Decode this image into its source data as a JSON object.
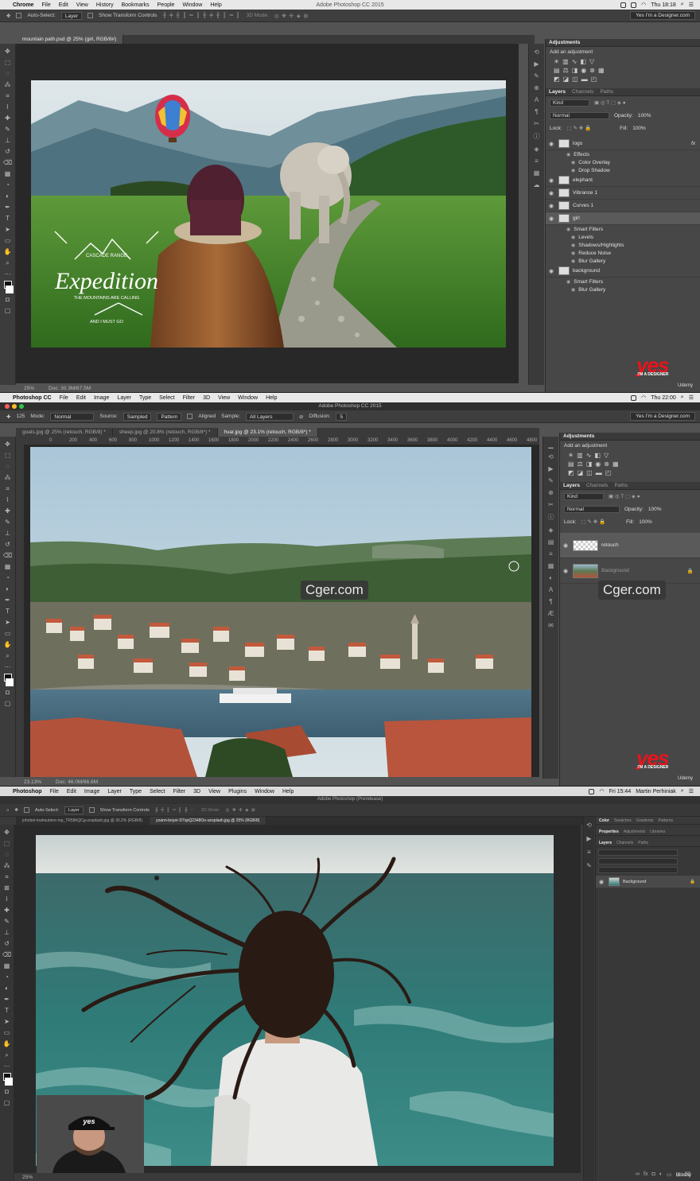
{
  "screen1": {
    "menubar": {
      "app": "Chrome",
      "items": [
        "File",
        "Edit",
        "View",
        "History",
        "Bookmarks",
        "People",
        "Window",
        "Help"
      ],
      "title": "Adobe Photoshop CC 2015",
      "clock": "Thu 18:18"
    },
    "options": {
      "auto_select_label": "Auto-Select:",
      "auto_select_value": "Layer",
      "transform_label": "Show Transform Controls",
      "mode3d": "3D Mode:",
      "workspace": "Yes I'm a Designer.com"
    },
    "tabs": [
      "mountain path.psd @ 25% (girl, RGB/8#)"
    ],
    "status": {
      "zoom": "25%",
      "doc": "Doc: 30.3M/67.5M"
    },
    "artwork": {
      "badge_top": "CASCADE RANGE",
      "badge_title": "Expedition",
      "badge_sub": "THE MOUNTAINS ARE CALLING",
      "badge_bottom": "AND I MUST GO"
    },
    "adjustments": {
      "title": "Adjustments",
      "add": "Add an adjustment"
    },
    "layers_panel": {
      "tabs": [
        "Layers",
        "Channels",
        "Paths"
      ],
      "kind": "Kind",
      "blend": "Normal",
      "opacity_label": "Opacity:",
      "opacity": "100%",
      "lock_label": "Lock:",
      "fill_label": "Fill:",
      "fill": "100%",
      "layers": [
        {
          "name": "logo",
          "kind": "main",
          "fx": "fx"
        },
        {
          "name": "Effects",
          "kind": "sub"
        },
        {
          "name": "Color Overlay",
          "kind": "sub2"
        },
        {
          "name": "Drop Shadow",
          "kind": "sub2"
        },
        {
          "name": "elephant",
          "kind": "main"
        },
        {
          "name": "Vibrance 1",
          "kind": "main"
        },
        {
          "name": "Curves 1",
          "kind": "main"
        },
        {
          "name": "girl",
          "kind": "main",
          "selected": true
        },
        {
          "name": "Smart Filters",
          "kind": "sub"
        },
        {
          "name": "Levels",
          "kind": "sub2"
        },
        {
          "name": "Shadows/Highlights",
          "kind": "sub2"
        },
        {
          "name": "Reduce Noise",
          "kind": "sub2"
        },
        {
          "name": "Blur Gallery",
          "kind": "sub2"
        },
        {
          "name": "background",
          "kind": "main"
        },
        {
          "name": "Smart Filters",
          "kind": "sub"
        },
        {
          "name": "Blur Gallery",
          "kind": "sub2"
        }
      ]
    }
  },
  "screen2": {
    "menubar": {
      "app": "Photoshop CC",
      "items": [
        "File",
        "Edit",
        "Image",
        "Layer",
        "Type",
        "Select",
        "Filter",
        "3D",
        "View",
        "Window",
        "Help"
      ],
      "title": "Adobe Photoshop CC 2015",
      "clock": "Thu 22:00"
    },
    "options": {
      "brush_size": "125",
      "mode_label": "Mode:",
      "mode": "Normal",
      "source_label": "Source:",
      "source_sampled": "Sampled",
      "source_pattern": "Pattern",
      "aligned": "Aligned",
      "sample_label": "Sample:",
      "sample": "All Layers",
      "diffusion_label": "Diffusion:",
      "diffusion": "5",
      "workspace": "Yes I'm a Designer.com"
    },
    "tabs": [
      "goats.jpg @ 25% (retouch, RGB/8) *",
      "sheep.jpg @ 20.8% (retouch, RGB/8*) *",
      "hvar.jpg @ 23.1% (retouch, RGB/8*) *"
    ],
    "ruler": [
      "0",
      "200",
      "400",
      "600",
      "800",
      "1000",
      "1200",
      "1400",
      "1600",
      "1800",
      "2000",
      "2200",
      "2400",
      "2600",
      "2800",
      "3000",
      "3200",
      "3400",
      "3600",
      "3800",
      "4000",
      "4200",
      "4400",
      "4600",
      "4800"
    ],
    "status": {
      "zoom": "23.13%",
      "doc": "Doc: 46.0M/66.6M"
    },
    "watermark": "Cger.com",
    "adjustments": {
      "title": "Adjustments",
      "add": "Add an adjustment"
    },
    "layers_panel": {
      "tabs": [
        "Layers",
        "Channels",
        "Paths"
      ],
      "kind": "Kind",
      "blend": "Normal",
      "opacity_label": "Opacity:",
      "opacity": "100%",
      "lock_label": "Lock:",
      "fill_label": "Fill:",
      "fill": "100%",
      "layers": [
        {
          "name": "retouch",
          "selected": true
        },
        {
          "name": "Background"
        }
      ]
    }
  },
  "screen3": {
    "menubar": {
      "app": "Photoshop",
      "items": [
        "File",
        "Edit",
        "Image",
        "Layer",
        "Type",
        "Select",
        "Filter",
        "3D",
        "View",
        "Plugins",
        "Window",
        "Help"
      ],
      "title": "Adobe Photoshop (Prerelease)",
      "clock": "Fri 15:44",
      "user": "Martin Perhiniak"
    },
    "options": {
      "auto_select_label": "Auto-Select:",
      "auto_select_value": "Layer",
      "transform_label": "Show Transform Controls",
      "mode3d": "3D Mode:"
    },
    "tabs": [
      "johnbel-mahoutiere-mp_TR59hQCg-unsplash.jpg @ 30.2% (RGB/8)",
      "yoann-boyer-D7qoQ2348Oo-unsplash.jpg @ 25% (RGB/8)"
    ],
    "status": {
      "zoom": "25%"
    },
    "right_panel": {
      "row1": [
        "Color",
        "Swatches",
        "Gradients",
        "Patterns"
      ],
      "row2": [
        "Properties",
        "Adjustments",
        "Libraries"
      ],
      "row3": [
        "Layers",
        "Channels",
        "Paths"
      ],
      "layer": "Background"
    },
    "cap_text": "yes"
  },
  "branding": {
    "yes": "yes",
    "tag": "I'M A DESIGNER",
    "udemy": "Udemy",
    "red": "#e8141b"
  }
}
